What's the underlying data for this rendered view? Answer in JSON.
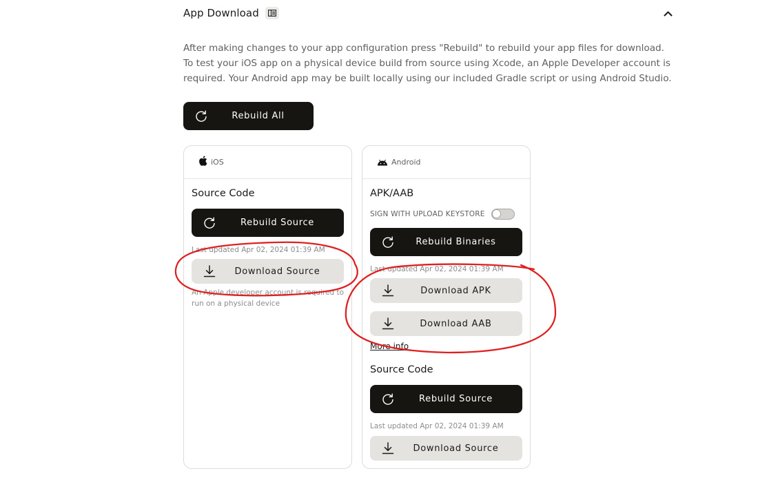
{
  "section": {
    "title": "App Download",
    "title_icon": "sidebar-panel-icon",
    "collapse_icon": "chevron-up-icon"
  },
  "description": "After making changes to your app configuration press \"Rebuild\" to rebuild your app files for download. To test your iOS app on a physical device build from source using Xcode, an Apple Developer account is required. Your Android app may be built locally using our included Gradle script or using Android Studio.",
  "rebuild_all": {
    "label": "Rebuild All",
    "icon": "refresh-icon"
  },
  "ios": {
    "platform": "iOS",
    "platform_icon": "apple-icon",
    "source_title": "Source Code",
    "rebuild_source_label": "Rebuild Source",
    "last_updated": "Last updated Apr 02, 2024 01:39 AM",
    "download_source_label": "Download Source",
    "note": "An Apple developer account is required to run on a physical device"
  },
  "android": {
    "platform": "Android",
    "platform_icon": "android-icon",
    "apk_title": "APK/AAB",
    "sign_label": "SIGN WITH UPLOAD KEYSTORE",
    "sign_enabled": false,
    "rebuild_binaries_label": "Rebuild Binaries",
    "binaries_last_updated": "Last updated Apr 02, 2024 01:39 AM",
    "download_apk_label": "Download APK",
    "download_aab_label": "Download AAB",
    "more_info": "More info",
    "source_title": "Source Code",
    "rebuild_source_label": "Rebuild Source",
    "source_last_updated": "Last updated Apr 02, 2024 01:39 AM",
    "download_source_label": "Download Source"
  },
  "colors": {
    "dark_button": "#171512",
    "light_button": "#e5e3df",
    "annotation": "#e02020"
  }
}
